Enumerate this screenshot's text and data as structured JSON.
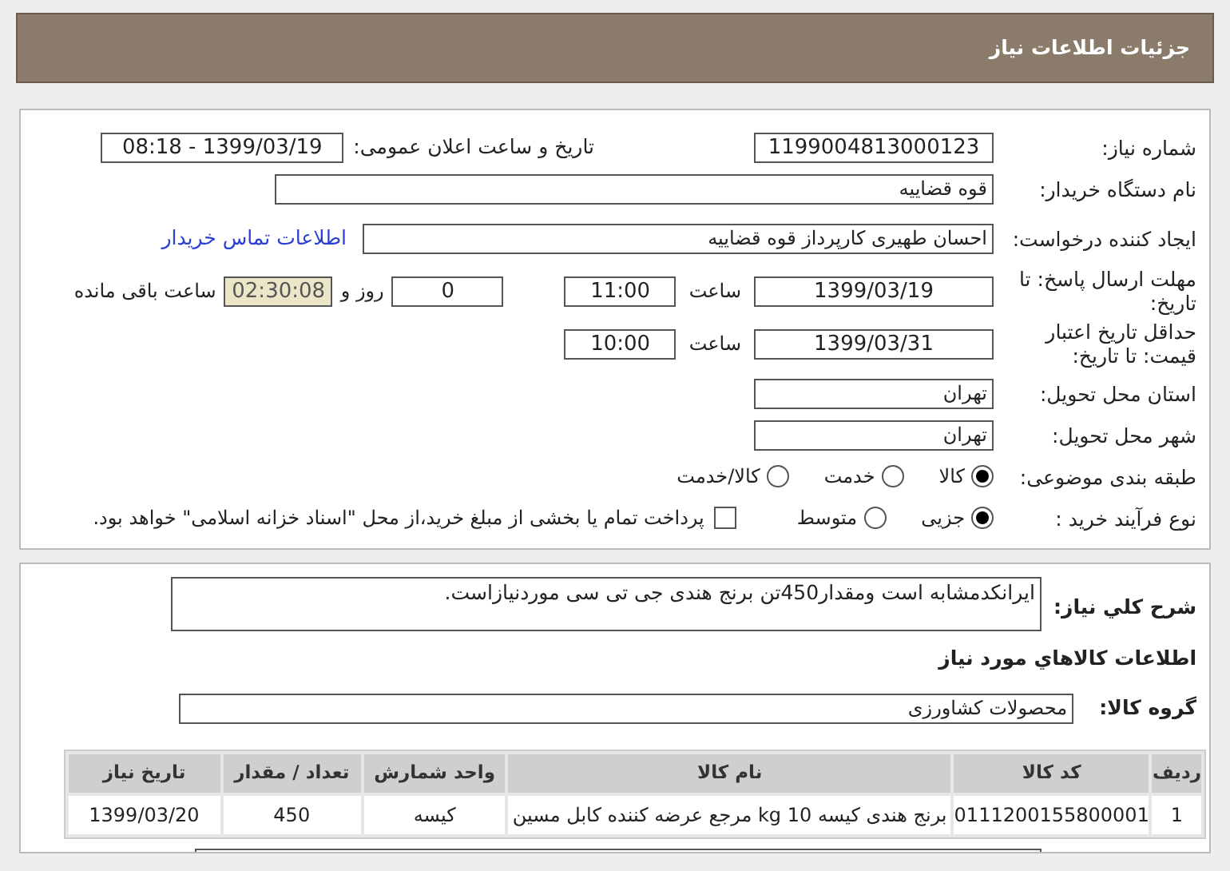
{
  "header": {
    "title": "جزئیات اطلاعات نیاز"
  },
  "need_number": {
    "label": "شماره نیاز:",
    "value": "1199004813000123"
  },
  "announce": {
    "label": "تاریخ و ساعت اعلان عمومی:",
    "value": "1399/03/19 - 08:18"
  },
  "buyer": {
    "label": "نام دستگاه خریدار:",
    "value": "قوه قضاییه"
  },
  "creator": {
    "label": "ایجاد کننده درخواست:",
    "value": "احسان طهیری کارپرداز قوه قضاییه",
    "link": "اطلاعات تماس خریدار"
  },
  "deadline": {
    "label": "مهلت ارسال پاسخ: تا تاریخ:",
    "date": "1399/03/19",
    "time_label": "ساعت",
    "time": "11:00",
    "days": "0",
    "days_label": "روز و",
    "remaining": "02:30:08",
    "remaining_label": "ساعت باقی مانده"
  },
  "validity": {
    "label": "حداقل تاریخ اعتبار قیمت: تا تاریخ:",
    "date": "1399/03/31",
    "time_label": "ساعت",
    "time": "10:00"
  },
  "province": {
    "label": "استان محل تحویل:",
    "value": "تهران"
  },
  "city": {
    "label": "شهر محل تحویل:",
    "value": "تهران"
  },
  "category": {
    "label": "طبقه بندی موضوعی:",
    "options": [
      {
        "label": "کالا",
        "selected": true
      },
      {
        "label": "خدمت",
        "selected": false
      },
      {
        "label": "کالا/خدمت",
        "selected": false
      }
    ]
  },
  "process": {
    "label": "نوع فرآیند خرید :",
    "options": [
      {
        "label": "جزیی",
        "selected": true
      },
      {
        "label": "متوسط",
        "selected": false
      }
    ],
    "payment": {
      "checked": false,
      "label": "پرداخت تمام یا بخشی از مبلغ خرید،از محل \"اسناد خزانه اسلامی\" خواهد بود."
    }
  },
  "description": {
    "label": "شرح کلي نياز:",
    "value": "ایرانکدمشابه است ومقدار450تن برنج هندی جی تی سی موردنیازاست."
  },
  "goods_heading": "اطلاعات كالاهاي مورد نياز",
  "group": {
    "label": "گروه کالا:",
    "value": "محصولات کشاورزی"
  },
  "table": {
    "columns": [
      "ردیف",
      "کد کالا",
      "نام کالا",
      "واحد شمارش",
      "تعداد / مقدار",
      "تاریخ نیاز"
    ],
    "rows": [
      [
        "1",
        "0111200155800001",
        "برنج هندی کیسه 10 kg مرجع عرضه کننده کابل مسین",
        "کیسه",
        "450",
        "1399/03/20"
      ]
    ]
  }
}
